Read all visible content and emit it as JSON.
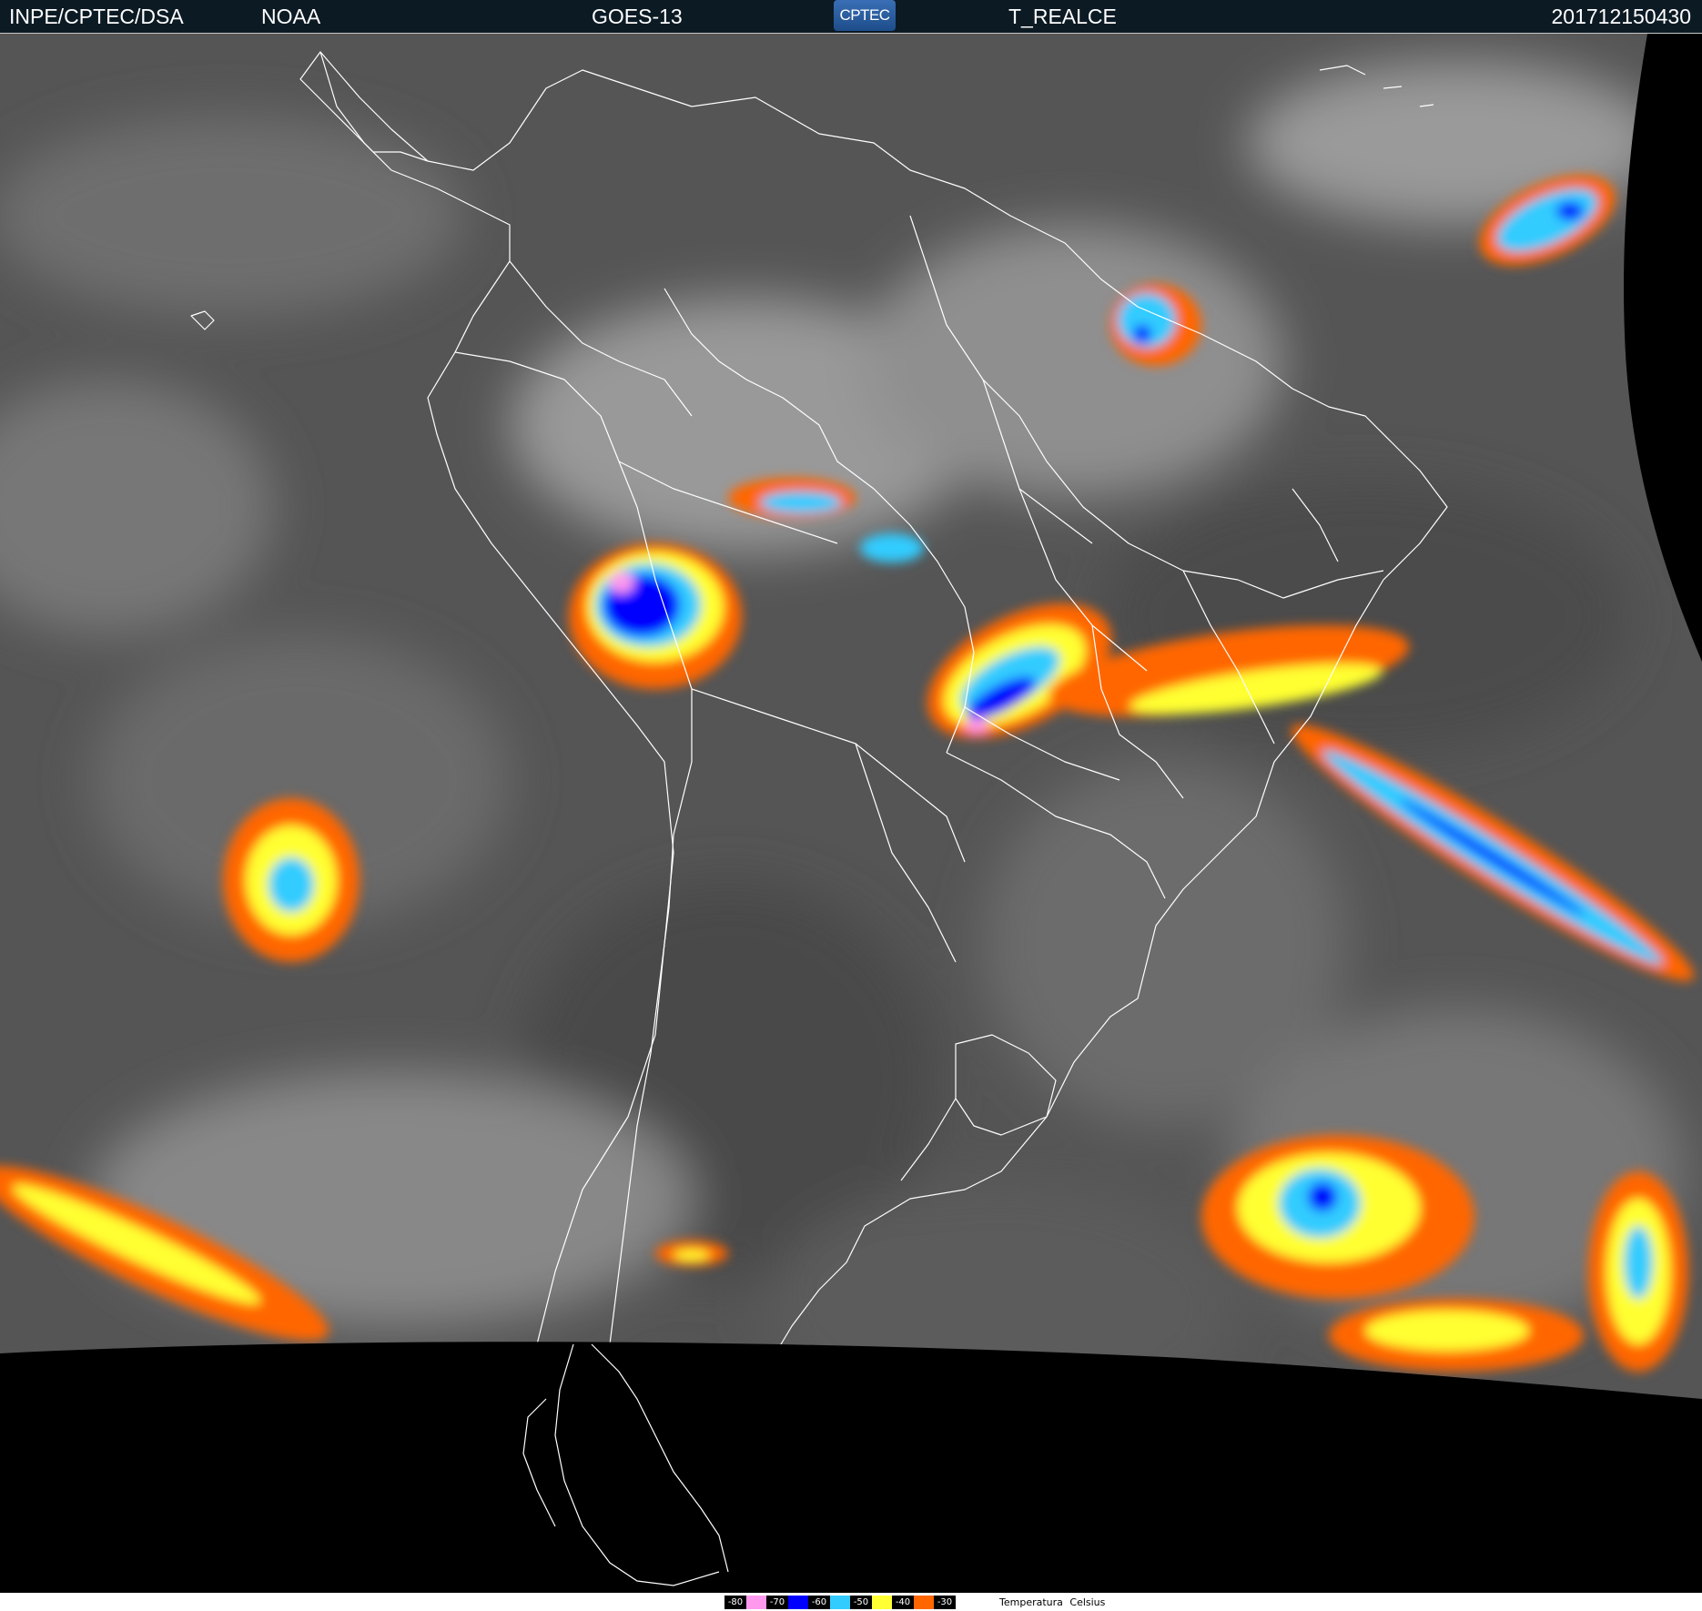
{
  "header": {
    "organization": "INPE/CPTEC/DSA",
    "agency": "NOAA",
    "satellite": "GOES-13",
    "logo_text": "CPTEC",
    "product": "T_REALCE",
    "timestamp": "201712150430"
  },
  "map": {
    "background_color": "#555555",
    "space_color": "#000000",
    "border_color": "#ffffff"
  },
  "legend": {
    "title": "Temperatura Celsius",
    "scale": [
      {
        "label": "-80",
        "color": "#ff99ee"
      },
      {
        "label": "-70",
        "color": "#0000ff"
      },
      {
        "label": "-60",
        "color": "#33ccff"
      },
      {
        "label": "-50",
        "color": "#ffff33"
      },
      {
        "label": "-40",
        "color": "#ff6600"
      },
      {
        "label": "-30",
        "color": "#ffffff"
      }
    ]
  }
}
